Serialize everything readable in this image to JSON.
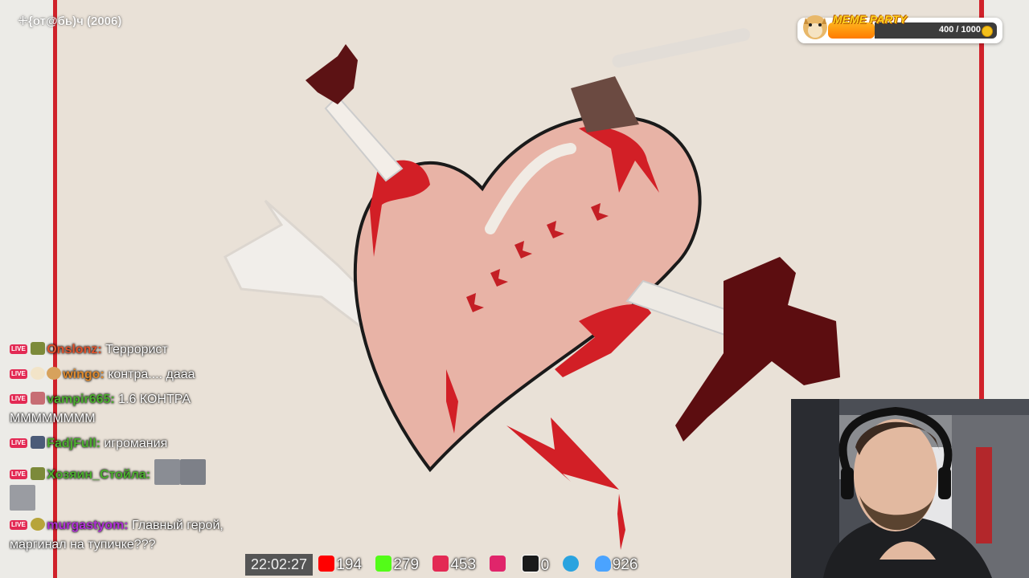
{
  "stream": {
    "title": "ꔰ{от@бь)ч (2006)"
  },
  "meme_party": {
    "title": "MEME PARTY",
    "progress": "400 / 1000",
    "fraction": 0.4
  },
  "chat": [
    {
      "platform": "LIVE",
      "nick": "Onslonz:",
      "nick_color": "#e0532d",
      "text": " Террорист"
    },
    {
      "platform": "LIVE",
      "nick": "wingo:",
      "nick_color": "#e08a2d",
      "text": " контра.... дааа"
    },
    {
      "platform": "LIVE",
      "nick": "vampir665:",
      "nick_color": "#4caf2f",
      "text": " 1.6  КОНТРА ММММММММ"
    },
    {
      "platform": "LIVE",
      "nick": "FadjFull:",
      "nick_color": "#4caf2f",
      "text": " игромания"
    },
    {
      "platform": "LIVE",
      "nick": "Хозяин_Стойла:",
      "nick_color": "#4caf2f",
      "text": ""
    },
    {
      "platform": "LIVE",
      "nick": "murgastyom:",
      "nick_color": "#b02fd6",
      "text": " Главный герой, маргинал на тупичке???"
    }
  ],
  "stats": {
    "time": "22:02:27",
    "youtube": "194",
    "kick": "279",
    "vk_live": "453",
    "other": "",
    "rutube": "0",
    "telegram": "",
    "viewers": "926"
  },
  "colors": {
    "youtube": "#ff0000",
    "kick": "#53fc18",
    "vk": "#e32a54",
    "rutube": "#1a1a1a",
    "telegram": "#2aa3df",
    "viewers": "#4aa3ff"
  }
}
